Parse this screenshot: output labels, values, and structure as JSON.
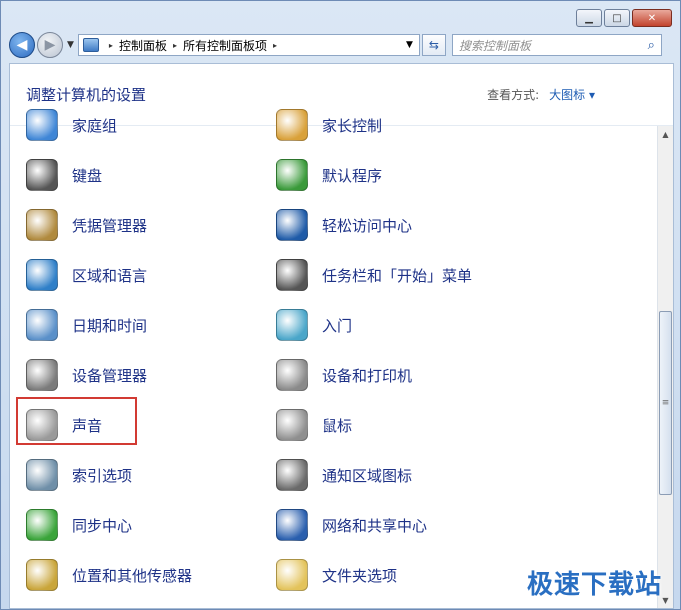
{
  "window": {
    "caption_buttons": {
      "minimize": "▁",
      "maximize": "□",
      "close": "✕"
    }
  },
  "navbar": {
    "back_glyph": "◀",
    "forward_glyph": "▶",
    "history_dropdown": "▼",
    "breadcrumb": [
      "控制面板",
      "所有控制面板项"
    ],
    "breadcrumb_sep": "▸",
    "address_dropdown": "▼",
    "refresh_glyph": "⇆",
    "search_placeholder": "搜索控制面板",
    "search_icon": "⌕"
  },
  "header": {
    "title": "调整计算机的设置",
    "view_by_label": "查看方式:",
    "view_by_value": "大图标 ▾"
  },
  "items": [
    {
      "label": "家庭组",
      "icon": "homegroup-icon",
      "color": "#3f86d6"
    },
    {
      "label": "家长控制",
      "icon": "parental-controls-icon",
      "color": "#d9a13a"
    },
    {
      "label": "键盘",
      "icon": "keyboard-icon",
      "color": "#555555"
    },
    {
      "label": "默认程序",
      "icon": "default-programs-icon",
      "color": "#3a9a3a"
    },
    {
      "label": "凭据管理器",
      "icon": "credential-manager-icon",
      "color": "#b08a3e"
    },
    {
      "label": "轻松访问中心",
      "icon": "ease-of-access-icon",
      "color": "#1f5ba8"
    },
    {
      "label": "区域和语言",
      "icon": "region-language-icon",
      "color": "#2f7fc8"
    },
    {
      "label": "任务栏和「开始」菜单",
      "icon": "taskbar-start-menu-icon",
      "color": "#555555"
    },
    {
      "label": "日期和时间",
      "icon": "date-time-icon",
      "color": "#5a90c9"
    },
    {
      "label": "入门",
      "icon": "getting-started-icon",
      "color": "#4aa6c9"
    },
    {
      "label": "设备管理器",
      "icon": "device-manager-icon",
      "color": "#7b7b7b"
    },
    {
      "label": "设备和打印机",
      "icon": "devices-printers-icon",
      "color": "#8a8a8a"
    },
    {
      "label": "声音",
      "icon": "sound-icon",
      "color": "#9a9a9a"
    },
    {
      "label": "鼠标",
      "icon": "mouse-icon",
      "color": "#8f8f8f"
    },
    {
      "label": "索引选项",
      "icon": "indexing-options-icon",
      "color": "#6f8fa8"
    },
    {
      "label": "通知区域图标",
      "icon": "notification-area-icon",
      "color": "#6a6a6a"
    },
    {
      "label": "同步中心",
      "icon": "sync-center-icon",
      "color": "#3aa43a"
    },
    {
      "label": "网络和共享中心",
      "icon": "network-sharing-icon",
      "color": "#2a5fae"
    },
    {
      "label": "位置和其他传感器",
      "icon": "location-sensors-icon",
      "color": "#c9a53a"
    },
    {
      "label": "文件夹选项",
      "icon": "folder-options-icon",
      "color": "#e3c35b"
    }
  ],
  "highlight_item": "声音",
  "scrollbar": {
    "up": "▲",
    "down": "▼",
    "grip": "≡"
  },
  "watermark": "极速下载站"
}
